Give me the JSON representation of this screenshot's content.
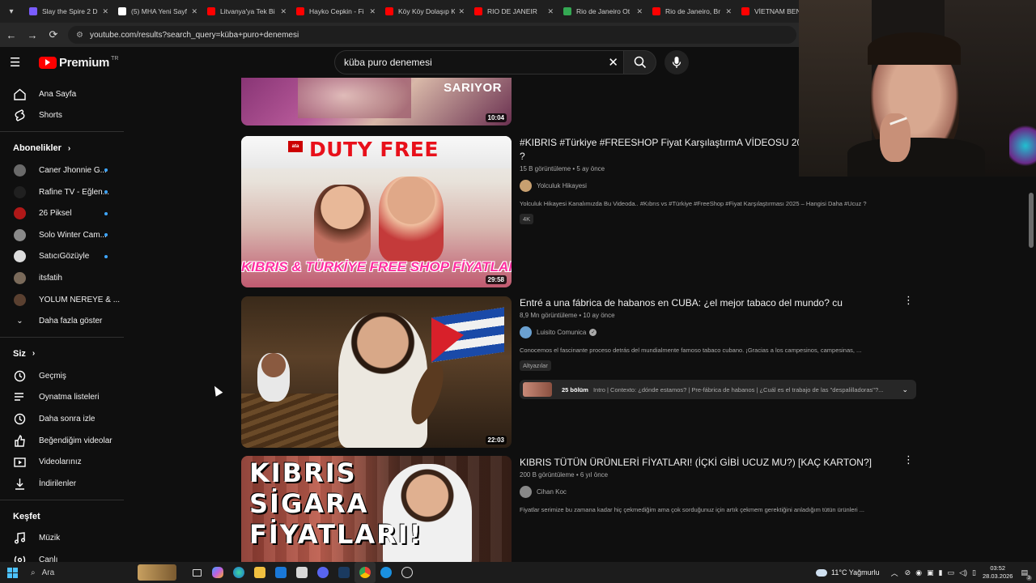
{
  "browser": {
    "tabs": [
      {
        "label": "Slay the Spire 2 D",
        "color": "#7a5cff"
      },
      {
        "label": "(5) MHA Yeni Sayf",
        "color": "#ffffff"
      },
      {
        "label": "Litvanya'ya Tek Bi",
        "color": "#ff0000"
      },
      {
        "label": "Hayko Cepkin - Fi",
        "color": "#ff0000"
      },
      {
        "label": "Köy Köy Dolaşıp K",
        "color": "#ff0000"
      },
      {
        "label": "RIO DE JANEIR",
        "color": "#ff0000"
      },
      {
        "label": "Rio de Janeiro Ot",
        "color": "#34a853"
      },
      {
        "label": "Rio de Janeiro, Br",
        "color": "#ff0000"
      },
      {
        "label": "VİETNAM BENİ",
        "color": "#ff0000"
      }
    ],
    "url": "youtube.com/results?search_query=küba+puro+denemesi"
  },
  "header": {
    "logo_word": "Premium",
    "logo_country": "TR",
    "search_value": "küba puro denemesi"
  },
  "sidebar": {
    "main": [
      {
        "label": "Ana Sayfa",
        "icon": "home-icon"
      },
      {
        "label": "Shorts",
        "icon": "shorts-icon"
      }
    ],
    "subs_title": "Abonelikler",
    "subs": [
      {
        "label": "Caner Jhonnie G...",
        "color": "#6a6a6a",
        "dot": true
      },
      {
        "label": "Rafine TV - Eğlen...",
        "color": "#202020",
        "dot": true
      },
      {
        "label": "26 Piksel",
        "color": "#b01818",
        "dot": true
      },
      {
        "label": "Solo Winter Cam...",
        "color": "#8a8a8a",
        "dot": true
      },
      {
        "label": "SatıcıGözüyle",
        "color": "#dddddd",
        "dot": true
      },
      {
        "label": "itsfatih",
        "color": "#7a6a5a",
        "dot": false
      },
      {
        "label": "YOLUM NEREYE & ...",
        "color": "#5a4030",
        "dot": false
      }
    ],
    "show_more": "Daha fazla göster",
    "you_title": "Siz",
    "you": [
      {
        "label": "Geçmiş",
        "icon": "history-icon"
      },
      {
        "label": "Oynatma listeleri",
        "icon": "playlists-icon"
      },
      {
        "label": "Daha sonra izle",
        "icon": "watch-later-icon"
      },
      {
        "label": "Beğendiğim videolar",
        "icon": "liked-icon"
      },
      {
        "label": "Videolarınız",
        "icon": "your-videos-icon"
      },
      {
        "label": "İndirilenler",
        "icon": "downloads-icon"
      }
    ],
    "explore_title": "Keşfet",
    "explore": [
      {
        "label": "Müzik",
        "icon": "music-icon"
      },
      {
        "label": "Canlı",
        "icon": "live-icon"
      }
    ]
  },
  "results": [
    {
      "title": "",
      "duration": "10:04",
      "overlay_text": "SARIYOR"
    },
    {
      "title": "#KIBRIS #Türkiye #FREESHOP Fiyat KarşılaştırmA VİDEOSU 2025 - Hangisi Daha #UCUZ ?",
      "stats": "15 B görüntüleme • 5 ay önce",
      "channel": "Yolculuk Hikayesi",
      "channel_color": "#c8a070",
      "verified": false,
      "desc": "Yolculuk Hikayesi Kanalımızda Bu Videoda.. #Kıbrıs vs #Türkiye #FreeShop #Fiyat Karşılaştırması 2025 – Hangisi Daha #Ucuz ?",
      "badge": "4K",
      "duration": "29:58",
      "thumb_top": "DUTY FREE",
      "thumb_bottom": "KIBRIS & TÜRKİYE FREE SHOP FİYATLARI",
      "thumb_logo": "ata"
    },
    {
      "title": "Entré a una fábrica de habanos en CUBA: ¿el mejor tabaco del mundo? cu",
      "stats": "8,9 Mn görüntüleme • 10 ay önce",
      "channel": "Luisito Comunica",
      "channel_color": "#6aa0d0",
      "verified": true,
      "desc": "Conocemos el fascinante proceso detrás del mundialmente famoso tabaco cubano. ¡Gracias a los campesinos, campesinas, ...",
      "badge": "Altyazılar",
      "chapters_count": "25 bölüm",
      "chapters_text": "Intro | Contexto: ¿dónde estamos? | Pre-fábrica de habanos | ¿Cuál es el trabajo de las \"despalilladoras\"?...",
      "duration": "22:03"
    },
    {
      "title": "KIBRIS TÜTÜN ÜRÜNLERİ FİYATLARI! (İÇKİ GİBİ UCUZ MU?) [KAÇ KARTON?]",
      "stats": "200 B görüntüleme • 6 yıl önce",
      "channel": "Cihan Koc",
      "channel_color": "#888888",
      "verified": false,
      "desc": "Fiyatlar serimize bu zamana kadar hiç çekmediğim ama çok sorduğunuz için artık çekmem gerektiğini anladığım tütün ürünleri ...",
      "thumb_lines": [
        "KIBRIS",
        "SİGARA",
        "FİYATLARI!"
      ]
    }
  ],
  "taskbar": {
    "search_placeholder": "Ara",
    "weather": "11°C  Yağmurlu",
    "time": "03:52",
    "date": "28.03.2026",
    "notif_count": "3"
  }
}
